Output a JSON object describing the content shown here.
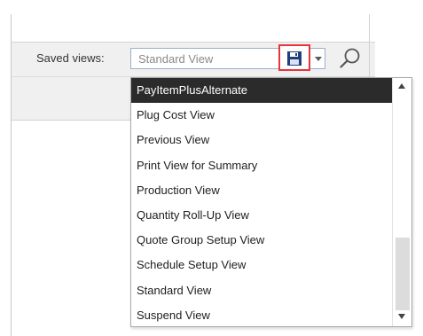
{
  "toolbar": {
    "saved_views_label": "Saved views:",
    "combo_value": "Standard View",
    "save_icon": "floppy-disk-icon",
    "dropdown_icon": "caret-down-icon",
    "search_icon": "magnifier-icon",
    "highlight_color": "#e8343f"
  },
  "dropdown": {
    "selected_index": 0,
    "items": [
      "PayItemPlusAlternate",
      "Plug Cost View",
      "Previous View",
      "Print View for Summary",
      "Production View",
      "Quantity Roll-Up View",
      "Quote Group Setup View",
      "Schedule Setup View",
      "Standard View",
      "Suspend View"
    ]
  }
}
